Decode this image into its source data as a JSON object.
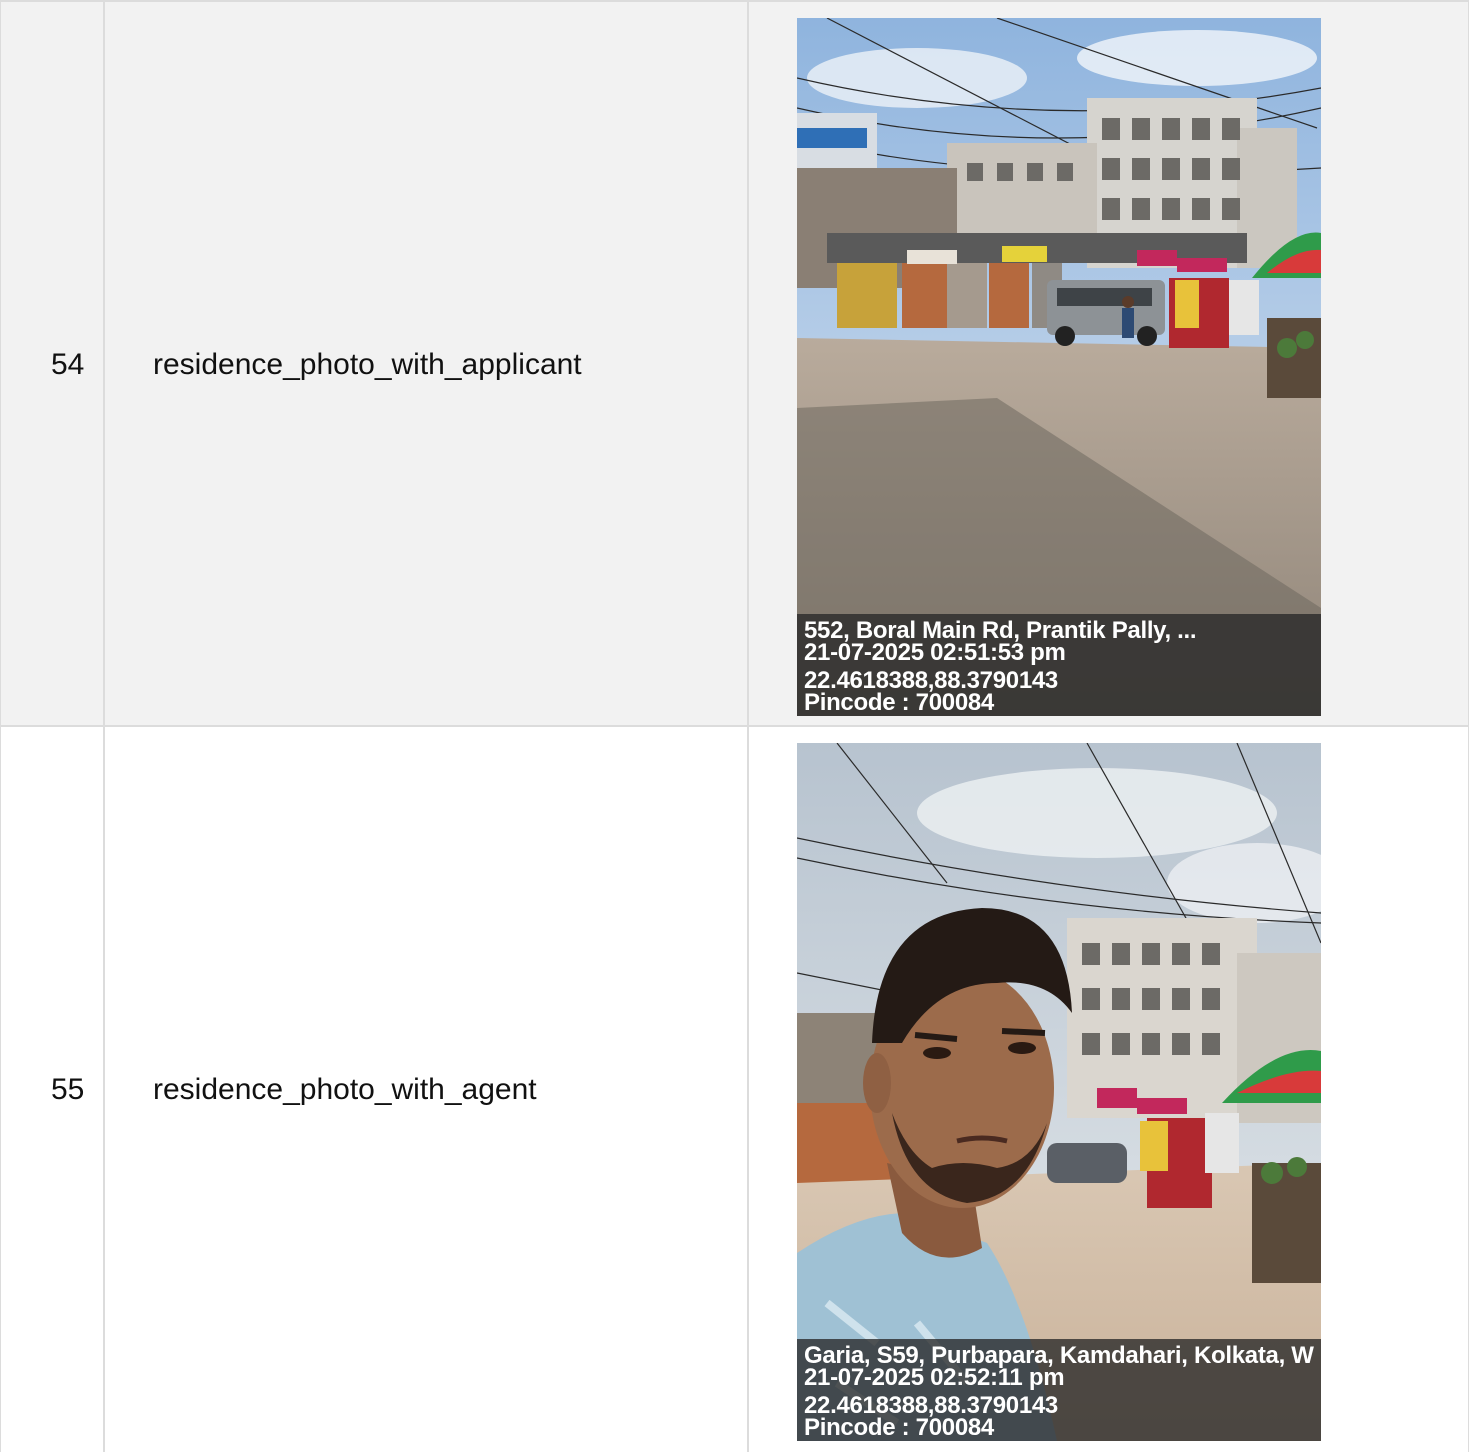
{
  "rows": [
    {
      "number": "54",
      "field": "residence_photo_with_applicant",
      "photo": {
        "address": "552, Boral Main Rd, Prantik Pally, ...",
        "datetime": "21-07-2025 02:51:53 pm",
        "coordinates": "22.4618388,88.3790143",
        "pincode": "Pincode : 700084"
      }
    },
    {
      "number": "55",
      "field": "residence_photo_with_agent",
      "photo": {
        "address": "Garia, S59, Purbapara, Kamdahari, Kolkata, W",
        "datetime": "21-07-2025 02:52:11 pm",
        "coordinates": "22.4618388,88.3790143",
        "pincode": "Pincode : 700084"
      }
    }
  ]
}
